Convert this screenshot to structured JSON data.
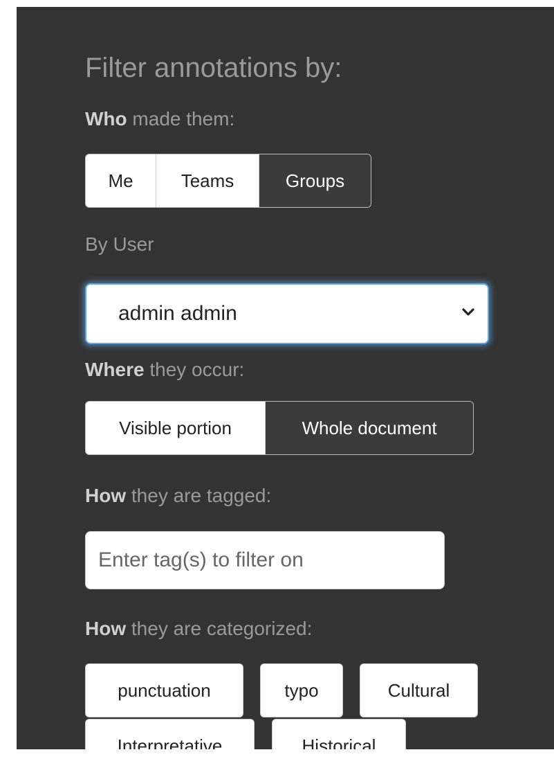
{
  "filter": {
    "heading": "Filter annotations by:",
    "who": {
      "label_bold": "Who",
      "label_rest": " made them:",
      "options": [
        "Me",
        "Teams",
        "Groups"
      ],
      "selected": "Groups"
    },
    "by_user": {
      "label": "By User",
      "selected_value": "admin admin"
    },
    "where": {
      "label_bold": "Where",
      "label_rest": " they occur:",
      "options": [
        "Visible portion",
        "Whole document"
      ],
      "selected": "Whole document"
    },
    "tagged": {
      "label_bold": "How",
      "label_rest": " they are tagged:",
      "placeholder": "Enter tag(s) to filter on",
      "value": ""
    },
    "categorized": {
      "label_bold": "How",
      "label_rest": " they are categorized:",
      "categories": [
        "punctuation",
        "typo",
        "Cultural",
        "Interpretative",
        "Historical"
      ]
    }
  },
  "colors": {
    "panel_background": "#333333",
    "active_button": "#3b3b3b",
    "focus_ring": "#5aa6e8"
  }
}
